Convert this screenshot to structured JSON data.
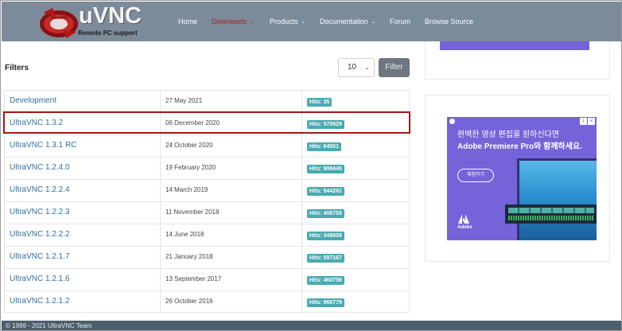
{
  "header": {
    "logo_title": "uVNC",
    "logo_subtitle": "Remote PC support",
    "logo_badge": "UltraVNC",
    "nav": [
      {
        "label": "Home",
        "dropdown": false,
        "active": false
      },
      {
        "label": "Downloads",
        "dropdown": true,
        "active": true
      },
      {
        "label": "Products",
        "dropdown": true,
        "active": false
      },
      {
        "label": "Documentation",
        "dropdown": true,
        "active": false
      },
      {
        "label": "Forum",
        "dropdown": false,
        "active": false
      },
      {
        "label": "Browse Source",
        "dropdown": false,
        "active": false
      }
    ]
  },
  "filters": {
    "label": "Filters",
    "page_size": "10",
    "button_label": "Filter"
  },
  "downloads": [
    {
      "name": "Development",
      "date": "27 May 2021",
      "hits": "Hits: 35"
    },
    {
      "name": "UltraVNC 1.3.2",
      "date": "06 December 2020",
      "hits": "Hits: 570929"
    },
    {
      "name": "UltraVNC 1.3.1 RC",
      "date": "24 October 2020",
      "hits": "Hits: 64001"
    },
    {
      "name": "UltraVNC 1.2.4.0",
      "date": "19 February 2020",
      "hits": "Hits: 908445"
    },
    {
      "name": "UltraVNC 1.2.2.4",
      "date": "14 March 2019",
      "hits": "Hits: 544261"
    },
    {
      "name": "UltraVNC 1.2.2.3",
      "date": "11 November 2018",
      "hits": "Hits: 406755"
    },
    {
      "name": "UltraVNC 1.2.2.2",
      "date": "14 June 2018",
      "hits": "Hits: 348608"
    },
    {
      "name": "UltraVNC 1.2.1.7",
      "date": "21 January 2018",
      "hits": "Hits: 597167"
    },
    {
      "name": "UltraVNC 1.2.1.6",
      "date": "13 September 2017",
      "hits": "Hits: 460756"
    },
    {
      "name": "UltraVNC 1.2.1.2",
      "date": "26 October 2016",
      "hits": "Hits: 966779"
    }
  ],
  "ad": {
    "line1": "완벽한 영상 편집을 원하신다면",
    "line2": "Adobe Premiere Pro와 함께하세요.",
    "cta": "체험하기",
    "brand": "Adobe",
    "icons": [
      "info-icon",
      "close-icon"
    ]
  },
  "footer": {
    "text": "© 1999 - 2021 UltraVNC Team"
  },
  "colors": {
    "navbar": "#7b8b99",
    "nav_active": "#b21f1f",
    "link": "#2f6fa7",
    "hits_badge": "#4aa9b1",
    "highlight": "#a41818",
    "ad_background": "#7463d9",
    "footer": "#4b5f6f"
  }
}
